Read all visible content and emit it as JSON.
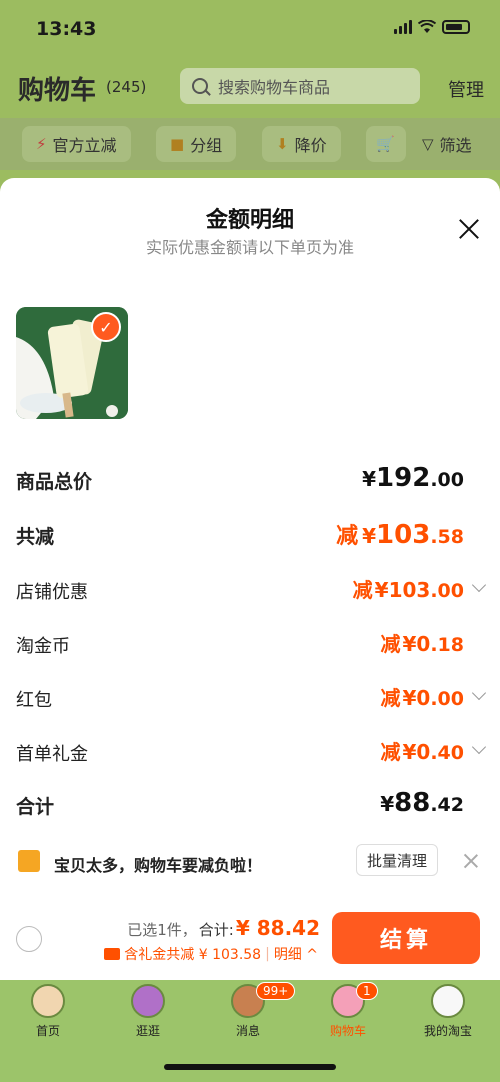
{
  "status_bar": {
    "time": "13:43"
  },
  "header": {
    "title": "购物车",
    "count": "(245)",
    "search_placeholder": "搜索购物车商品",
    "manage": "管理"
  },
  "filters": [
    {
      "label": "官方立减",
      "icon": "lightning-icon"
    },
    {
      "label": "分组",
      "icon": "folder-icon"
    },
    {
      "label": "降价",
      "icon": "down-arrow-icon"
    },
    {
      "label": "",
      "icon": "cart-icon"
    },
    {
      "label": "筛选",
      "icon": "filter-icon"
    }
  ],
  "sheet": {
    "title": "金额明细",
    "subtitle": "实际优惠金额请以下单页为准",
    "rows": [
      {
        "label": "商品总价",
        "prefix": "",
        "currency": "¥",
        "int": "192",
        "dec": ".00",
        "style": "black-bold"
      },
      {
        "label": "共减",
        "prefix": "减",
        "currency": "¥",
        "int": "103",
        "dec": ".58",
        "style": "orange-bold"
      },
      {
        "label": "店铺优惠",
        "prefix": "减",
        "currency": "¥",
        "int": "103",
        "dec": ".00",
        "style": "orange",
        "chevron": true
      },
      {
        "label": "淘金币",
        "prefix": "减",
        "currency": "¥",
        "int": "0",
        "dec": ".18",
        "style": "orange"
      },
      {
        "label": "红包",
        "prefix": "减",
        "currency": "¥",
        "int": "0",
        "dec": ".00",
        "style": "orange",
        "chevron": true
      },
      {
        "label": "首单礼金",
        "prefix": "减",
        "currency": "¥",
        "int": "0",
        "dec": ".40",
        "style": "orange",
        "chevron": true
      },
      {
        "label": "合计",
        "prefix": "",
        "currency": "¥",
        "int": "88",
        "dec": ".42",
        "style": "black-bold"
      }
    ]
  },
  "tip": {
    "text": "宝贝太多，购物车要减负啦！",
    "button": "批量清理"
  },
  "checkout": {
    "selected": "已选1件，",
    "total_label": "合计:",
    "total_value": "¥ 88.42",
    "coupon_text": "含礼金共减 ¥ 103.58",
    "detail": "明细 ^",
    "button": "结算"
  },
  "tabbar": [
    {
      "label": "首页"
    },
    {
      "label": "逛逛"
    },
    {
      "label": "消息",
      "badge": "99+"
    },
    {
      "label": "购物车",
      "badge": "1",
      "active": true
    },
    {
      "label": "我的淘宝"
    }
  ],
  "colors": {
    "accent": "#ff5000",
    "green": "#9cbc60"
  }
}
